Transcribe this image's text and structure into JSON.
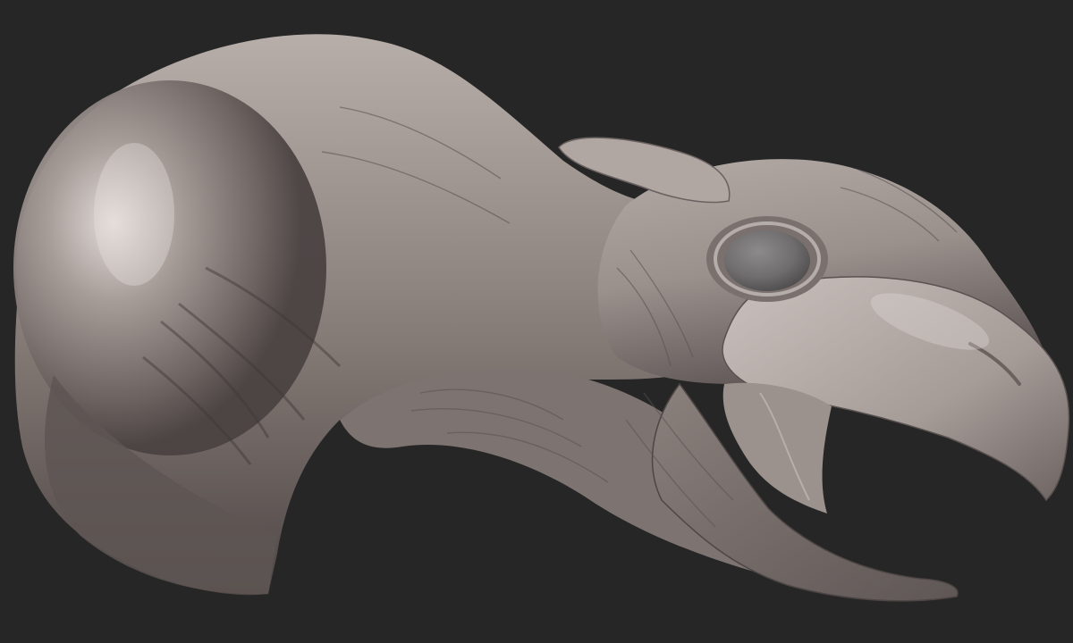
{
  "scene": {
    "subject": "sculpted-creature-head",
    "background_color": "#262626",
    "material_color": "#8f8580",
    "shadow_color": "#4a4342",
    "highlight_color": "#d9d2cf",
    "eye_color": "#6f6d6e"
  }
}
